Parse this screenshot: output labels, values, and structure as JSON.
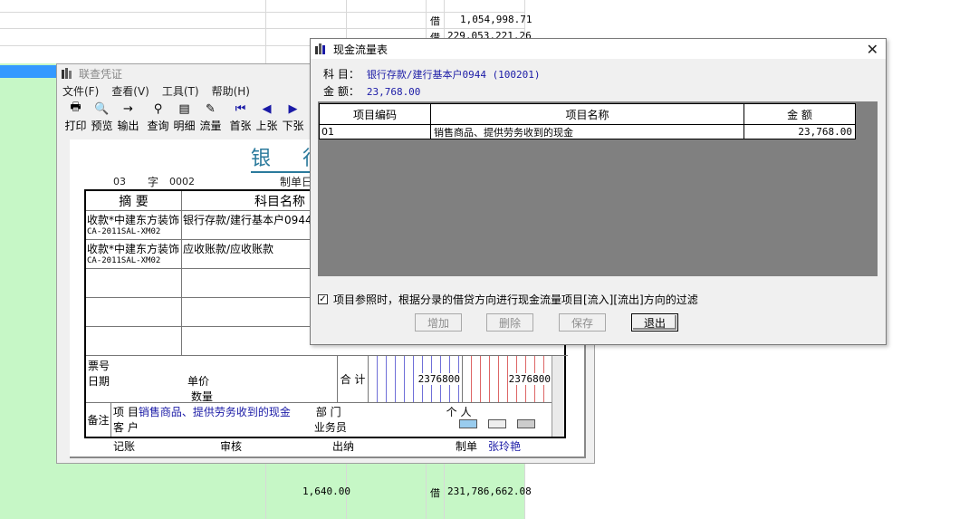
{
  "ledger": {
    "rows": [
      {
        "side": "借",
        "balance": "1,054,998.71"
      },
      {
        "side": "借",
        "balance": "229,053,221.26"
      }
    ],
    "bottom_row": {
      "credit": "1,640.00",
      "side": "借",
      "balance": "231,786,662.08"
    }
  },
  "voucher": {
    "title": "联查凭证",
    "menu": [
      "文件(F)",
      "查看(V)",
      "工具(T)",
      "帮助(H)"
    ],
    "toolbar": [
      {
        "label": "打印",
        "icon": "printer-icon",
        "glyph": "🖶"
      },
      {
        "label": "预览",
        "icon": "preview-icon",
        "glyph": "🔍"
      },
      {
        "label": "输出",
        "icon": "export-icon",
        "glyph": "→"
      },
      {
        "label": "查询",
        "icon": "binoculars-icon",
        "glyph": "⚲"
      },
      {
        "label": "明细",
        "icon": "detail-icon",
        "glyph": "▤"
      },
      {
        "label": "流量",
        "icon": "flow-icon",
        "glyph": "✎"
      },
      {
        "label": "首张",
        "icon": "first-icon",
        "glyph": "⏮"
      },
      {
        "label": "上张",
        "icon": "prev-icon",
        "glyph": "◀"
      },
      {
        "label": "下张",
        "icon": "next-icon",
        "glyph": "▶"
      }
    ],
    "paper_title": "银 行",
    "voucher_type": "03",
    "word_label": "字",
    "voucher_no": "0002",
    "date_label": "制单日",
    "header_summary": "摘 要",
    "header_account": "科目名称",
    "rows": [
      {
        "summary": "收款*中建东方装饰",
        "summary_code": "CA-2011SAL-XM02",
        "account": "银行存款/建行基本户0944"
      },
      {
        "summary": "收款*中建东方装饰",
        "summary_code": "CA-2011SAL-XM02",
        "account": "应收账款/应收账款"
      }
    ],
    "ticket_label": "票号",
    "date_row_label": "日期",
    "unit_price_label": "单价",
    "quantity_label": "数量",
    "total_label": "合 计",
    "total_debit": "2376800",
    "total_credit": "2376800",
    "remark_label": "备注",
    "project_label": "项  目",
    "project_value": "销售商品、提供劳务收到的现金",
    "customer_label": "客  户",
    "dept_label": "部  门",
    "staff_label": "业务员",
    "person_label": "个  人",
    "bookkeeper_label": "记账",
    "audit_label": "审核",
    "cashier_label": "出纳",
    "maker_label": "制单",
    "maker_name": "张玲艳"
  },
  "dialog": {
    "title": "现金流量表",
    "subject_label": "科 目：",
    "subject_value": "银行存款/建行基本户0944 (100201)",
    "amount_label": "金 额：",
    "amount_value": "23,768.00",
    "columns": [
      "项目编码",
      "项目名称",
      "金 额"
    ],
    "rows": [
      {
        "code": "01",
        "name": "销售商品、提供劳务收到的现金",
        "amount": "23,768.00"
      }
    ],
    "checkbox_label": "项目参照时，根据分录的借贷方向进行现金流量项目[流入][流出]方向的过滤",
    "checkbox_checked": "✓",
    "buttons": {
      "add": "增加",
      "delete": "删除",
      "save": "保存",
      "exit": "退出"
    }
  }
}
